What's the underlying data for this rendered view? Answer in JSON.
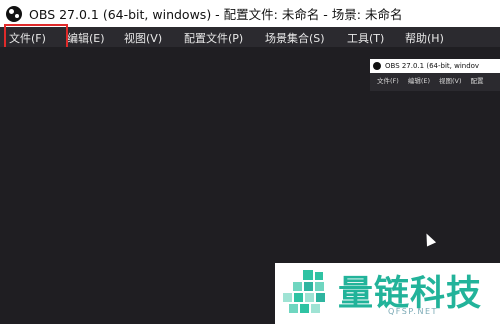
{
  "window": {
    "title": "OBS 27.0.1 (64-bit, windows) - 配置文件: 未命名 - 场景: 未命名"
  },
  "menu": {
    "items": [
      {
        "label": "文件(F)"
      },
      {
        "label": "编辑(E)"
      },
      {
        "label": "视图(V)"
      },
      {
        "label": "配置文件(P)"
      },
      {
        "label": "场景集合(S)"
      },
      {
        "label": "工具(T)"
      },
      {
        "label": "帮助(H)"
      }
    ]
  },
  "preview_window": {
    "title": "OBS 27.0.1 (64-bit, windov",
    "menu": [
      "文件(F)",
      "编辑(E)",
      "视图(V)",
      "配置"
    ]
  },
  "watermark": {
    "brand": "量链科技",
    "domain": "QFSP.NET"
  },
  "colors": {
    "background": "#1f1e22",
    "menubar": "#2b2a2f",
    "highlight_border": "#e02a2a",
    "watermark_text": "#22b39a"
  }
}
